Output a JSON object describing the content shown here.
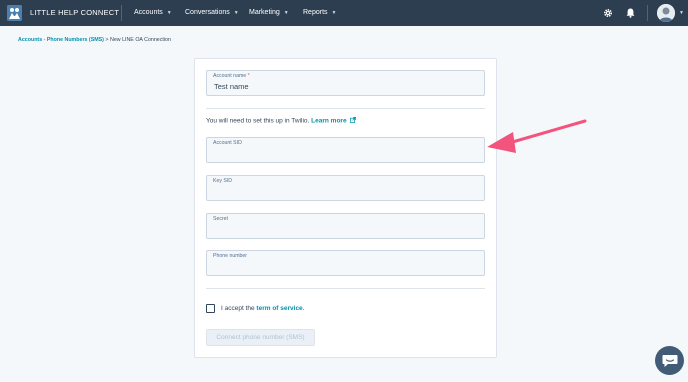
{
  "nav": {
    "brand": "LITTLE HELP CONNECT",
    "items": [
      {
        "label": "Accounts"
      },
      {
        "label": "Conversations"
      },
      {
        "label": "Marketing"
      },
      {
        "label": "Reports"
      }
    ],
    "icons": [
      "gear-icon",
      "bell-icon",
      "avatar"
    ]
  },
  "breadcrumb": {
    "link": "Accounts - Phone Numbers (SMS)",
    "separator": ">",
    "current": "New LINE OA Connection"
  },
  "form": {
    "account_name": {
      "label": "Account name",
      "required_mark": "*",
      "value": "Test name"
    },
    "info": {
      "text": "You will need to set this up in Twilio.",
      "link": "Learn more"
    },
    "account_sid": {
      "label": "Account SID",
      "value": ""
    },
    "key_sid": {
      "label": "Key SID",
      "value": ""
    },
    "secret": {
      "label": "Secret",
      "value": ""
    },
    "phone_number": {
      "label": "Phone number",
      "value": ""
    },
    "terms": {
      "prefix": "I accept the",
      "link": "term of service",
      "suffix": ".",
      "checked": false
    },
    "submit": {
      "label": "Connect phone number (SMS)",
      "disabled": true
    }
  },
  "colors": {
    "nav_bg": "#2d3e50",
    "link": "#0091ae",
    "annotation_arrow": "#f2547d",
    "chat_button": "#425b76"
  }
}
